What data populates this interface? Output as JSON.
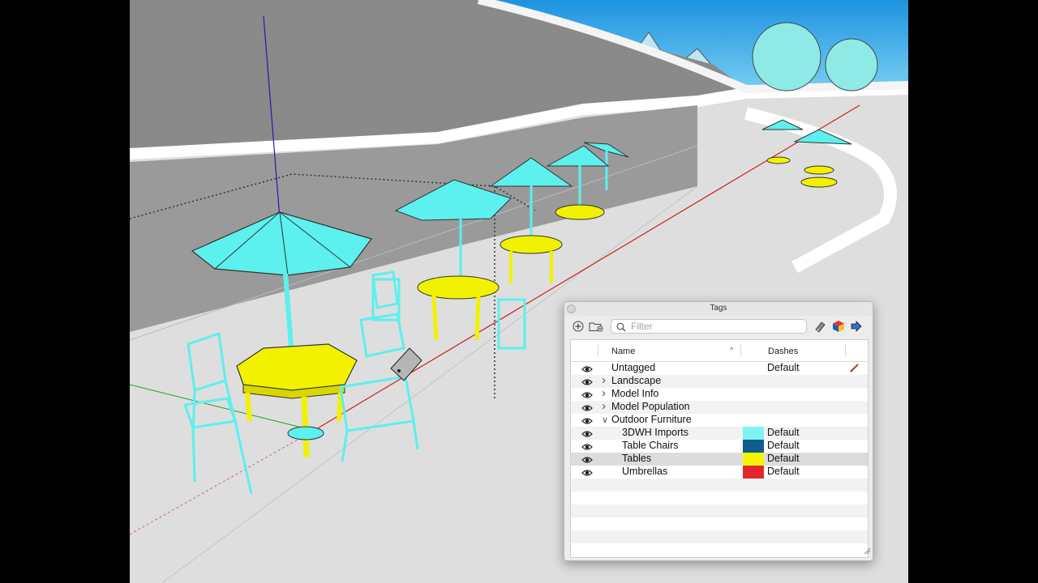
{
  "panel": {
    "title": "Tags",
    "filter_placeholder": "Filter"
  },
  "columns": {
    "name": "Name",
    "dashes": "Dashes"
  },
  "rows": [
    {
      "label": "Untagged",
      "dash": "Default",
      "color": "",
      "indent": 0,
      "expander": "none"
    },
    {
      "label": "Landscape",
      "dash": "",
      "color": "",
      "indent": 0,
      "expander": "collapsed"
    },
    {
      "label": "Model Info",
      "dash": "",
      "color": "",
      "indent": 0,
      "expander": "collapsed"
    },
    {
      "label": "Model Population",
      "dash": "",
      "color": "",
      "indent": 0,
      "expander": "collapsed"
    },
    {
      "label": "Outdoor Furniture",
      "dash": "",
      "color": "",
      "indent": 0,
      "expander": "expanded"
    },
    {
      "label": "3DWH Imports",
      "dash": "Default",
      "color": "#7ff3f3",
      "indent": 1,
      "expander": "none"
    },
    {
      "label": "Table Chairs",
      "dash": "Default",
      "color": "#0f5d8c",
      "indent": 1,
      "expander": "none"
    },
    {
      "label": "Tables",
      "dash": "Default",
      "color": "#f5f500",
      "indent": 1,
      "expander": "none"
    },
    {
      "label": "Umbrellas",
      "dash": "Default",
      "color": "#e3262c",
      "indent": 1,
      "expander": "none"
    }
  ],
  "selected_row": "Tables",
  "icons": {
    "visibility": "eye-icon",
    "add_tag": "plus-circle-icon",
    "add_folder": "folder-plus-icon",
    "search": "magnifier-icon",
    "tag_tool": "paint-tag-icon",
    "color_by_tag": "color-cube-icon",
    "details": "arrow-right-icon",
    "active_pencil": "pencil-icon"
  },
  "colors": {
    "umbrella": "#5cf0ee",
    "table": "#f2f200",
    "chair": "#5cf0ee",
    "sky": "#2fa5e8"
  }
}
